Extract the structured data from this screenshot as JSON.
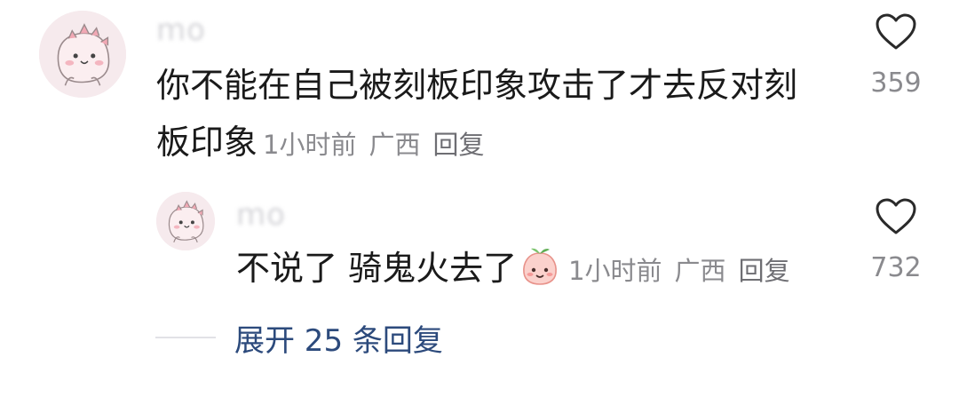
{
  "comments": [
    {
      "username": "mo",
      "text_line1": "你不能在自己被刻板印象攻击了才去反对刻",
      "text_line2": "板印象",
      "time": "1小时前",
      "location": "广西",
      "reply_label": "回复",
      "likes": "359"
    }
  ],
  "replies": [
    {
      "username": "mo",
      "text": "不说了 骑鬼火去了",
      "emoji": "smiling-peach-emoji",
      "time": "1小时前",
      "location": "广西",
      "reply_label": "回复",
      "likes": "732"
    }
  ],
  "expand": {
    "label": "展开 25 条回复"
  },
  "icons": {
    "like": "heart-outline-icon"
  },
  "colors": {
    "text": "#1a1a1a",
    "meta": "#8a8a8e",
    "link": "#2c4a7c",
    "avatar_bg": "#f6eaed"
  }
}
